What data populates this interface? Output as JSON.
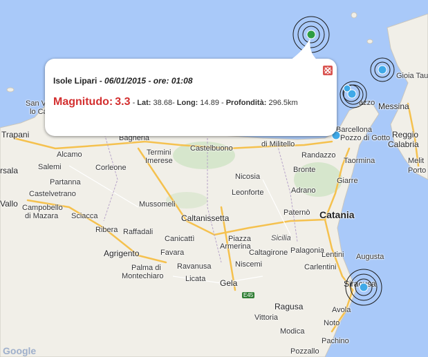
{
  "popup": {
    "place": "Isole Lipari",
    "date": "06/01/2015",
    "time_prefix": "ore:",
    "time": "01:08",
    "magnitude_label": "Magnitudo:",
    "magnitude": "3.3",
    "lat_label": "Lat:",
    "lat": "38.68",
    "long_label": "Long:",
    "long": "14.89",
    "depth_label": "Profondità:",
    "depth": "296.5km",
    "close_icon": "close-icon"
  },
  "labels": {
    "san_vito": "San Vito",
    "lo_capo": "lo Capo",
    "trapani": "Trapani",
    "marsala": "rsala",
    "salemi": "Salemi",
    "alcamo": "Alcamo",
    "partanna": "Partanna",
    "castelvetrano": "Castelvetrano",
    "vallo": "Vallo",
    "campobello": "Campobello",
    "di_mazara": "di Mazara",
    "sciacca": "Sciacca",
    "corleone": "Corleone",
    "bagheria": "Bagheria",
    "termini": "Termini",
    "imerese": "Imerese",
    "castelbuono": "Castelbuono",
    "militello": "di Militello",
    "mussomeli": "Mussomeli",
    "caltanissetta": "Caltanissetta",
    "ribera": "Ribera",
    "raffadali": "Raffadali",
    "agrigento": "Agrigento",
    "canicatti": "Canicattì",
    "favara": "Favara",
    "palma": "Palma di",
    "montechiaro": "Montechiaro",
    "ravanusa": "Ravanusa",
    "licata": "Licata",
    "gela": "Gela",
    "niscemi": "Niscemi",
    "piazza": "Piazza",
    "armerina": "Armerina",
    "caltagirone": "Caltagirone",
    "sicilia": "Sicilia",
    "nicosia": "Nicosia",
    "leonforte": "Leonforte",
    "randazzo": "Randazzo",
    "bronte": "Bronte",
    "adrano": "Adrano",
    "paterno": "Paternò",
    "catania": "Catania",
    "giarre": "Giarre",
    "taormina": "Taormina",
    "barcellona": "Barcellona",
    "pozzo_di_gotto": "Pozzo di Gotto",
    "messina": "Messina",
    "reggio": "Reggio",
    "calabria": "Calabria",
    "milazzo": "azzo",
    "melito": "Melit",
    "porto": "Porto S",
    "gioia": "Gioia Tau",
    "palagonia": "Palagonia",
    "lentini": "Lentini",
    "carlentini": "Carlentini",
    "augusta": "Augusta",
    "siracusa": "Siracusa",
    "ragusa": "Ragusa",
    "vittoria": "Vittoria",
    "avola": "Avola",
    "noto": "Noto",
    "modica": "Modica",
    "pachino": "Pachino",
    "pozzallo": "Pozzallo",
    "road_e45": "E45",
    "google": "Google"
  },
  "markers": [
    {
      "name": "quake-marker-lipari-selected",
      "color": "#2e9d43",
      "rings": 3
    },
    {
      "name": "quake-marker-gioia",
      "color": "#3fa9e8",
      "rings": 2
    },
    {
      "name": "quake-marker-milazzo",
      "color": "#3fa9e8",
      "rings": 3
    },
    {
      "name": "quake-marker-barcellona",
      "color": "#3fa9e8",
      "rings": 0
    },
    {
      "name": "quake-marker-siracusa",
      "color": "#3fa9e8",
      "rings": 3
    }
  ],
  "colors": {
    "sea": "#a9c9f9",
    "land": "#f1efe8",
    "magnitude": "#d32f2f"
  }
}
